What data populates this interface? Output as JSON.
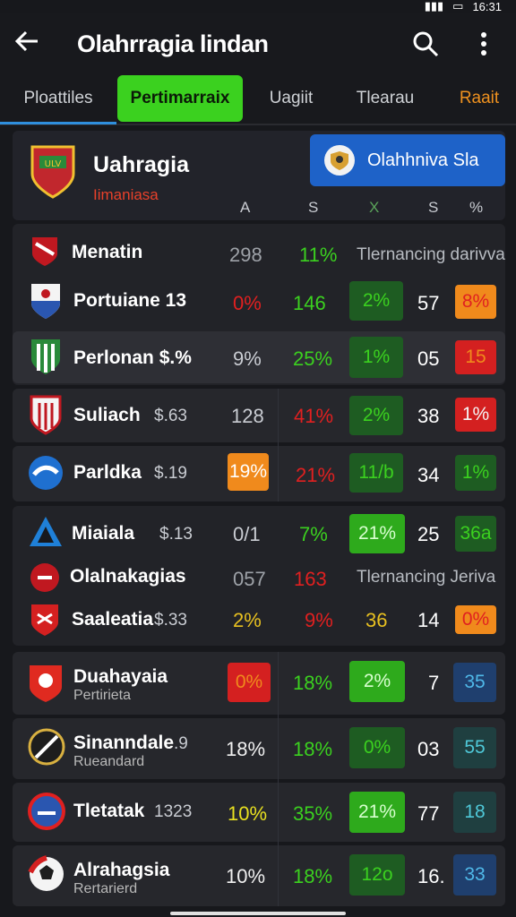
{
  "status": {
    "time": "16:31"
  },
  "appbar": {
    "title": "Olahrragia lindan"
  },
  "tabs": [
    {
      "label": "Ploattiles"
    },
    {
      "label": "Pertimarraix"
    },
    {
      "label": "Uagiit"
    },
    {
      "label": "Tlearau"
    },
    {
      "label": "Raait"
    }
  ],
  "header": {
    "team": "Uahragia",
    "sub": "Iimaniasa",
    "cta": "Olahhniva Sla",
    "cols": [
      "A",
      "S",
      "X",
      "S",
      "%"
    ]
  },
  "rows": [
    {
      "name": "Menatin",
      "val1": "298",
      "val2": "11%",
      "note": "Tlernancing darivva"
    },
    {
      "name": "Portuiane 13",
      "val1": "0%",
      "val2": "146",
      "val3": "2%",
      "val4": "57",
      "val5": "8%"
    },
    {
      "name": "Perlonan $.%",
      "val1": "9%",
      "val2": "25%",
      "val3": "1%",
      "val4": "05",
      "val5": "15"
    },
    {
      "name": "Suliach",
      "extra": "$.63",
      "val1": "128",
      "val2": "41%",
      "val3": "2%",
      "val4": "38",
      "val5": "1%"
    },
    {
      "name": "Parldka",
      "extra": "$.19",
      "val1": "19%",
      "val2": "21%",
      "val3": "11/b",
      "val4": "34",
      "val5": "1%"
    },
    {
      "name": "Miaiala",
      "extra": "$.13",
      "val1": "0/1",
      "val2": "7%",
      "val3": "21%",
      "val4": "25",
      "val5": "36a"
    },
    {
      "name": "Olalnakagias",
      "val1": "057",
      "val2": "163",
      "note": "Tlernancing Jeriva"
    },
    {
      "name": "Saaleatia",
      "extra": "$.33",
      "val1": "2%",
      "val2": "9%",
      "val3": "36",
      "val4": "14",
      "val5": "0%"
    },
    {
      "name": "Duahayaia",
      "sub": "Pertirieta",
      "val1": "0%",
      "val2": "18%",
      "val3": "2%",
      "val4": "7",
      "val5": "35"
    },
    {
      "name": "Sinanndale",
      "extra": ".9",
      "sub": "Rueandard",
      "val1": "18%",
      "val2": "18%",
      "val3": "0%",
      "val4": "03",
      "val5": "55"
    },
    {
      "name": "Tletatak",
      "extra": "1323",
      "val1": "10%",
      "val2": "35%",
      "val3": "21%",
      "val4": "77",
      "val5": "18"
    },
    {
      "name": "Alrahagsia",
      "sub": "Rertarierd",
      "val1": "10%",
      "val2": "18%",
      "val3": "12o",
      "val4": "16.",
      "val5": "33"
    }
  ],
  "colors": {
    "green": "#3bd11f",
    "red": "#e02020",
    "orange": "#f08a1c",
    "blue": "#1e62c8"
  }
}
